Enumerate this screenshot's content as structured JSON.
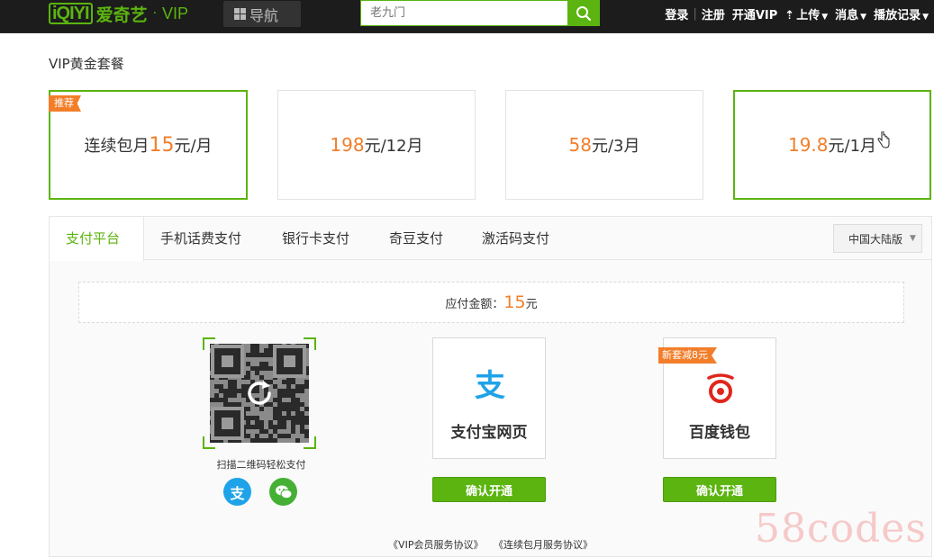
{
  "header": {
    "logo_mark": "iQIYI",
    "logo_text": "爱奇艺",
    "logo_dot": "·",
    "logo_vip": "VIP",
    "nav_label": "导航",
    "search_placeholder": "老九门",
    "links": {
      "login": "登录",
      "register": "注册",
      "open_vip": "开通VIP",
      "upload": "上传",
      "messages": "消息",
      "history": "播放记录"
    }
  },
  "packages": {
    "title": "VIP黄金套餐",
    "items": [
      {
        "badge": "推荐",
        "prefix": "连续包月",
        "price": "15",
        "suffix": "元/月",
        "selected": true
      },
      {
        "badge": "",
        "prefix": "",
        "price": "198",
        "suffix": "元/12月",
        "selected": false
      },
      {
        "badge": "",
        "prefix": "",
        "price": "58",
        "suffix": "元/3月",
        "selected": false
      },
      {
        "badge": "",
        "prefix": "",
        "price": "19.8",
        "suffix": "元/1月",
        "selected": true
      }
    ]
  },
  "payment": {
    "tabs": [
      "支付平台",
      "手机话费支付",
      "银行卡支付",
      "奇豆支付",
      "激活码支付"
    ],
    "active_tab": 0,
    "region": "中国大陆版",
    "amount_label": "应付金额：",
    "amount_value": "15",
    "amount_unit": "元",
    "qr_caption": "扫描二维码轻松支付",
    "methods": [
      {
        "name": "支付宝网页",
        "badge": "",
        "button": "确认开通"
      },
      {
        "name": "百度钱包",
        "badge": "新套减8元",
        "button": "确认开通"
      }
    ],
    "agreements": [
      "《VIP会员服务协议》",
      "《连续包月服务协议》"
    ]
  },
  "watermark": "58codes",
  "colors": {
    "brand_green": "#5bb40f",
    "price_orange": "#f27e2a",
    "topbar": "#1c1c1c",
    "alipay_blue": "#1fa3e8",
    "baidu_red": "#e0261b"
  }
}
